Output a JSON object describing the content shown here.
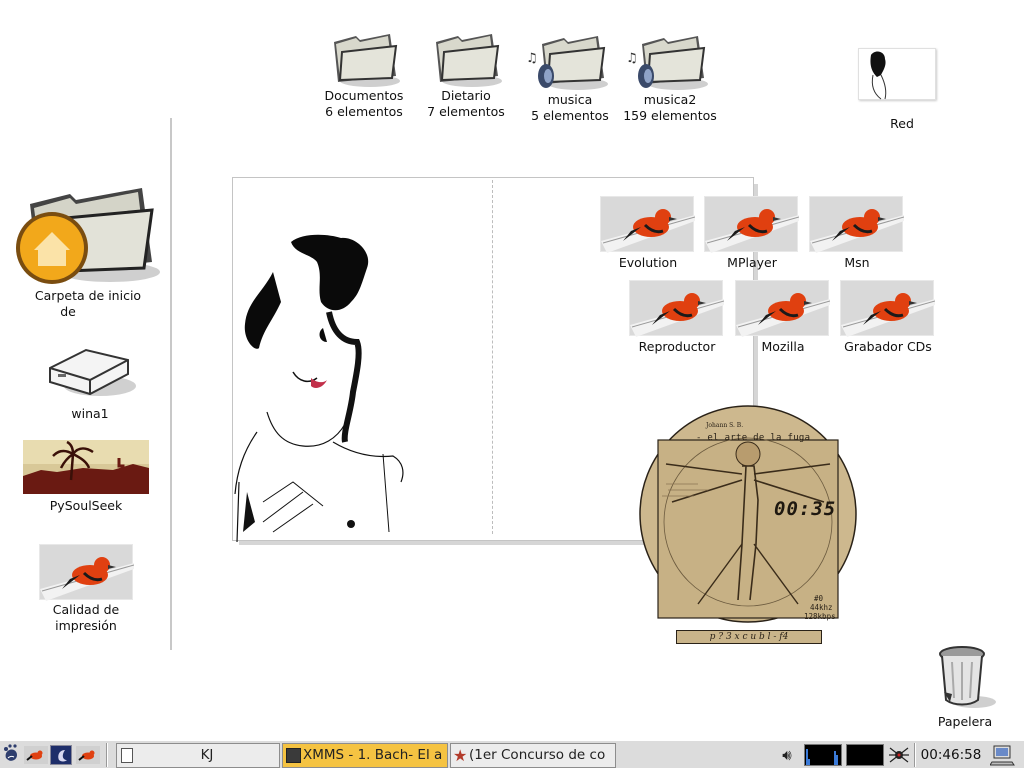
{
  "top_icons": [
    {
      "name": "Documentos",
      "count": "6 elementos",
      "music": false
    },
    {
      "name": "Dietario",
      "count": "7 elementos",
      "music": false
    },
    {
      "name": "musica",
      "count": "5 elementos",
      "music": true
    },
    {
      "name": "musica2",
      "count": "159 elementos",
      "music": true
    }
  ],
  "network": {
    "label": "Red"
  },
  "left_icons": {
    "home": {
      "line1": "Carpeta de inicio",
      "line2": "de"
    },
    "drive": {
      "label": "wina1"
    },
    "soulseek": {
      "label": "PySoulSeek"
    },
    "print": {
      "line1": "Calidad de",
      "line2": "impresión"
    }
  },
  "apps_row1": [
    "Evolution",
    "MPlayer",
    "Msn"
  ],
  "apps_row2": [
    "Reproductor",
    "Mozilla",
    "Grabador CDs"
  ],
  "xmms_skin": {
    "title_small": "Johann S. B.",
    "subtitle": "- el arte de la fuga",
    "time": "00:35",
    "track_num": "#0",
    "khz": "44khz",
    "kbps": "128kbps",
    "controls": "p ? 3 x c u b l - f4"
  },
  "trash": {
    "label": "Papelera"
  },
  "taskbar": {
    "tasks": [
      {
        "label": "KJ",
        "active": false
      },
      {
        "label": "XMMS - 1. Bach- El a",
        "active": true
      },
      {
        "label": "(1er Concurso de co",
        "active": false
      }
    ],
    "clock": "00:46:58"
  },
  "colors": {
    "folder": "#d8d8cc",
    "home_badge": "#f2a81b",
    "bird_tile": "#d9d9d9",
    "xmms_parchment": "#c9b48a",
    "taskbar_active": "#f5c342"
  }
}
